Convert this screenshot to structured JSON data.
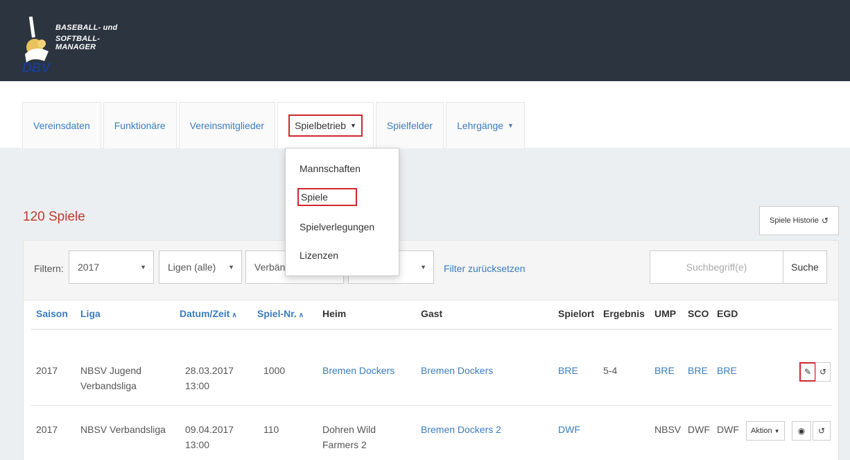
{
  "header": {
    "brand_line1": "BASEBALL- und",
    "brand_line2": "SOFTBALL-MANAGER",
    "logo_text": "DBV"
  },
  "tabs": [
    {
      "label": "Vereinsdaten",
      "has_caret": false
    },
    {
      "label": "Funktionäre",
      "has_caret": false
    },
    {
      "label": "Vereinsmitglieder",
      "has_caret": false
    },
    {
      "label": "Spielbetrieb",
      "has_caret": true,
      "active": true
    },
    {
      "label": "Spielfelder",
      "has_caret": false
    },
    {
      "label": "Lehrgänge",
      "has_caret": true
    }
  ],
  "dropdown": {
    "items": [
      "Mannschaften",
      "Spiele",
      "Spielverlegungen",
      "Lizenzen"
    ],
    "selected": "Spiele"
  },
  "page": {
    "title": "120 Spiele",
    "history_button": "Spiele Historie"
  },
  "filters": {
    "label": "Filtern:",
    "season": "2017",
    "league": "Ligen (alle)",
    "association": "Verbän",
    "fourth": "",
    "reset_link": "Filter zurücksetzen",
    "search_placeholder": "Suchbegriff(e)",
    "search_button": "Suche"
  },
  "table": {
    "headers": {
      "saison": "Saison",
      "liga": "Liga",
      "datum": "Datum/Zeit",
      "spielnr": "Spiel-Nr.",
      "heim": "Heim",
      "gast": "Gast",
      "spielort": "Spielort",
      "ergebnis": "Ergebnis",
      "ump": "UMP",
      "sco": "SCO",
      "egd": "EGD"
    },
    "rows": [
      {
        "saison": "2017",
        "liga1": "NBSV Jugend",
        "liga2": "Verbandsliga",
        "datum1": "28.03.2017",
        "datum2": "13:00",
        "spielnr": "1000",
        "heim1": "Bremen Dockers",
        "heim2": "",
        "gast": "Bremen Dockers",
        "spielort": "BRE",
        "ergebnis": "5-4",
        "ump": "BRE",
        "sco": "BRE",
        "egd": "BRE"
      },
      {
        "saison": "2017",
        "liga1": "NBSV Verbandsliga",
        "liga2": "",
        "datum1": "09.04.2017",
        "datum2": "13:00",
        "spielnr": "110",
        "heim1": "Dohren Wild",
        "heim2": "Farmers 2",
        "gast": "Bremen Dockers 2",
        "spielort": "DWF",
        "ergebnis": "",
        "ump": "NBSV",
        "sco": "DWF",
        "egd": "DWF",
        "aktion": "Aktion"
      }
    ]
  },
  "colors": {
    "header_bg": "#2c3440",
    "link": "#3a7cbf",
    "highlight": "#d0252f",
    "title": "#c0392b"
  }
}
